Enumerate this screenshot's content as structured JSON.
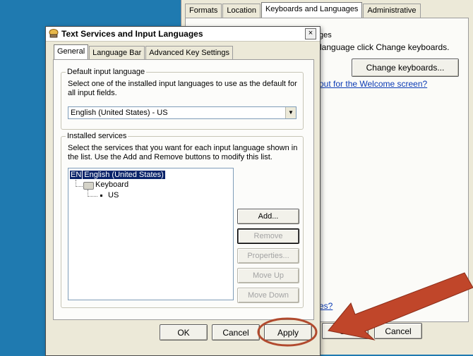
{
  "background_window": {
    "tabs": [
      "Formats",
      "Location",
      "Keyboards and Languages",
      "Administrative"
    ],
    "active_tab": 2,
    "partial_text_1": "ges",
    "partial_text_2": "language click Change keyboards.",
    "change_keyboards_button": "Change keyboards...",
    "welcome_link": "out for the Welcome screen?",
    "partial_link_2": "es?",
    "ok_button": "OK",
    "cancel_button": "Cancel"
  },
  "dialog": {
    "title": "Text Services and Input Languages",
    "close_label": "×",
    "tabs": [
      "General",
      "Language Bar",
      "Advanced Key Settings"
    ],
    "active_tab": 0,
    "default_group": {
      "label": "Default input language",
      "description": "Select one of the installed input languages to use as the default for all input fields.",
      "selected_value": "English (United States) - US"
    },
    "installed_group": {
      "label": "Installed services",
      "description": "Select the services that you want for each input language shown in the list. Use the Add and Remove buttons to modify this list.",
      "tree": {
        "lang_badge": "EN",
        "language": "English (United States)",
        "category": "Keyboard",
        "layout": "US"
      },
      "buttons": {
        "add": "Add...",
        "remove": "Remove",
        "properties": "Properties...",
        "move_up": "Move Up",
        "move_down": "Move Down"
      }
    },
    "footer": {
      "ok": "OK",
      "cancel": "Cancel",
      "apply": "Apply"
    }
  },
  "colors": {
    "desktop": "#1f7ab0",
    "selection": "#0a246a",
    "annotation_arrow": "#c0462a"
  }
}
